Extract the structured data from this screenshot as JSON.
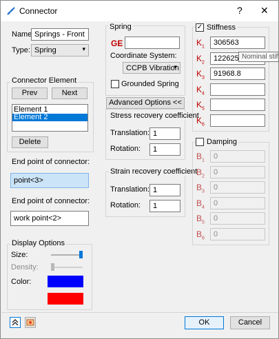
{
  "window": {
    "title": "Connector",
    "help": "?",
    "close": "✕"
  },
  "left": {
    "name_label": "Name:",
    "name_value": "Springs - Front",
    "type_label": "Type:",
    "type_value": "Spring",
    "connector_element_title": "Connector Element",
    "prev_label": "Prev",
    "next_label": "Next",
    "elements": [
      {
        "label": "Element 1",
        "selected": false
      },
      {
        "label": "Element 2",
        "selected": true
      }
    ],
    "delete_label": "Delete",
    "end1_label": "End point of connector:",
    "end1_value": "point<3>",
    "end2_label": "End point of connector:",
    "end2_value": "work point<2>",
    "display_title": "Display Options",
    "size_label": "Size:",
    "density_label": "Density:",
    "color_label": "Color:",
    "color1": "#0000ff",
    "color2": "#ff0000",
    "size_level": 1.0,
    "density_level": 0.0
  },
  "middle": {
    "spring_title": "Spring",
    "ge_label": "GE",
    "ge_value": "",
    "coord_label": "Coordinate System:",
    "coord_value": "CCPB Vibration I",
    "grounded_label": "Grounded Spring",
    "grounded_checked": false,
    "advanced_label": "Advanced Options <<",
    "stress_title": "Stress recovery coefficient",
    "stress_translation_label": "Translation:",
    "stress_translation_value": "1",
    "stress_rotation_label": "Rotation:",
    "stress_rotation_value": "1",
    "strain_title": "Strain recovery coefficient",
    "strain_translation_label": "Translation:",
    "strain_translation_value": "1",
    "strain_rotation_label": "Rotation:",
    "strain_rotation_value": "1"
  },
  "right": {
    "stiffness_label": "Stiffness",
    "stiffness_checked": true,
    "stiffness": [
      {
        "sym": "K",
        "sub": "1",
        "value": "306563"
      },
      {
        "sym": "K",
        "sub": "2",
        "value": "122625"
      },
      {
        "sym": "K",
        "sub": "3",
        "value": "91968.8"
      },
      {
        "sym": "K",
        "sub": "4",
        "value": ""
      },
      {
        "sym": "K",
        "sub": "5",
        "value": ""
      },
      {
        "sym": "K",
        "sub": "6",
        "value": ""
      }
    ],
    "tooltip": "Nominal stiff",
    "damping_label": "Damping",
    "damping_checked": false,
    "damping": [
      {
        "sym": "B",
        "sub": "1",
        "value": "0"
      },
      {
        "sym": "B",
        "sub": "2",
        "value": "0"
      },
      {
        "sym": "B",
        "sub": "3",
        "value": "0"
      },
      {
        "sym": "B",
        "sub": "4",
        "value": "0"
      },
      {
        "sym": "B",
        "sub": "5",
        "value": "0"
      },
      {
        "sym": "B",
        "sub": "6",
        "value": "0"
      }
    ]
  },
  "footer": {
    "ok_label": "OK",
    "cancel_label": "Cancel",
    "icon1": "collapse-up-icon",
    "icon2": "display-settings-icon"
  },
  "colors": {
    "k_label": "#c00000",
    "selection": "#0078d7"
  }
}
